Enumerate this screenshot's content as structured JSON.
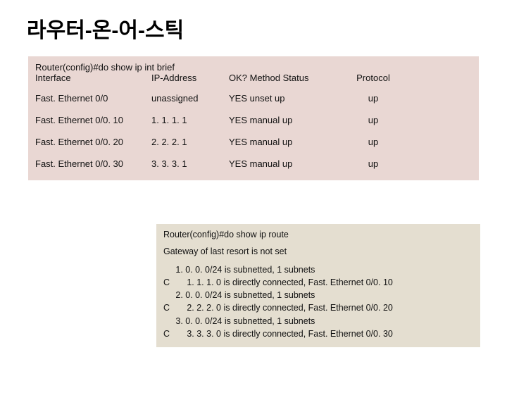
{
  "title": "라우터-온-어-스틱",
  "panel1": {
    "cmd": "Router(config)#do show ip int brief",
    "cols": {
      "iface": "Interface",
      "ip": "IP-Address",
      "ok": "OK? Method Status",
      "proto": "Protocol"
    },
    "rows": [
      {
        "iface": "Fast. Ethernet 0/0",
        "ip": "unassigned",
        "mid": "YES unset  up",
        "proto": "up"
      },
      {
        "iface": "Fast. Ethernet 0/0. 10",
        "ip": "1. 1. 1. 1",
        "mid": "YES manual up",
        "proto": "up"
      },
      {
        "iface": "Fast. Ethernet 0/0. 20",
        "ip": "2. 2. 2. 1",
        "mid": "YES manual up",
        "proto": "up"
      },
      {
        "iface": "Fast. Ethernet 0/0. 30",
        "ip": "3. 3. 3. 1",
        "mid": "YES manual up",
        "proto": "up"
      }
    ]
  },
  "panel2": {
    "cmd": "Router(config)#do show ip route",
    "gateway": "Gateway of last resort is not set",
    "routes": "     1. 0. 0. 0/24 is subnetted, 1 subnets\nC       1. 1. 1. 0 is directly connected, Fast. Ethernet 0/0. 10\n     2. 0. 0. 0/24 is subnetted, 1 subnets\nC       2. 2. 2. 0 is directly connected, Fast. Ethernet 0/0. 20\n     3. 0. 0. 0/24 is subnetted, 1 subnets\nC       3. 3. 3. 0 is directly connected, Fast. Ethernet 0/0. 30"
  }
}
